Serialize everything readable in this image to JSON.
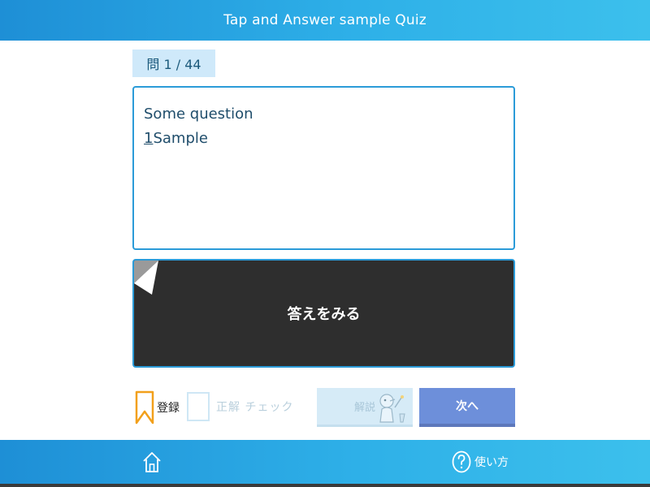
{
  "header": {
    "title": "Tap and Answer sample Quiz"
  },
  "question": {
    "number_label": "問 1 / 44",
    "lines": [
      "Some question"
    ],
    "option_number": "1",
    "option_text": "Sample"
  },
  "answer_card": {
    "label": "答えをみる"
  },
  "controls": {
    "bookmark_label": "登録",
    "check_label": "正解 チェック",
    "explain_label": "解説",
    "next_label": "次へ"
  },
  "footer": {
    "help_label": "使い方"
  },
  "colors": {
    "header_blue": "#2eb0e8",
    "card_dark": "#2e2e2e",
    "next_button": "#6d8fda",
    "bookmark_orange": "#f2a01b"
  },
  "icons": {
    "home": "home-icon",
    "help": "question-circle-icon",
    "bookmark": "bookmark-icon",
    "mascot": "mascot-icon"
  }
}
